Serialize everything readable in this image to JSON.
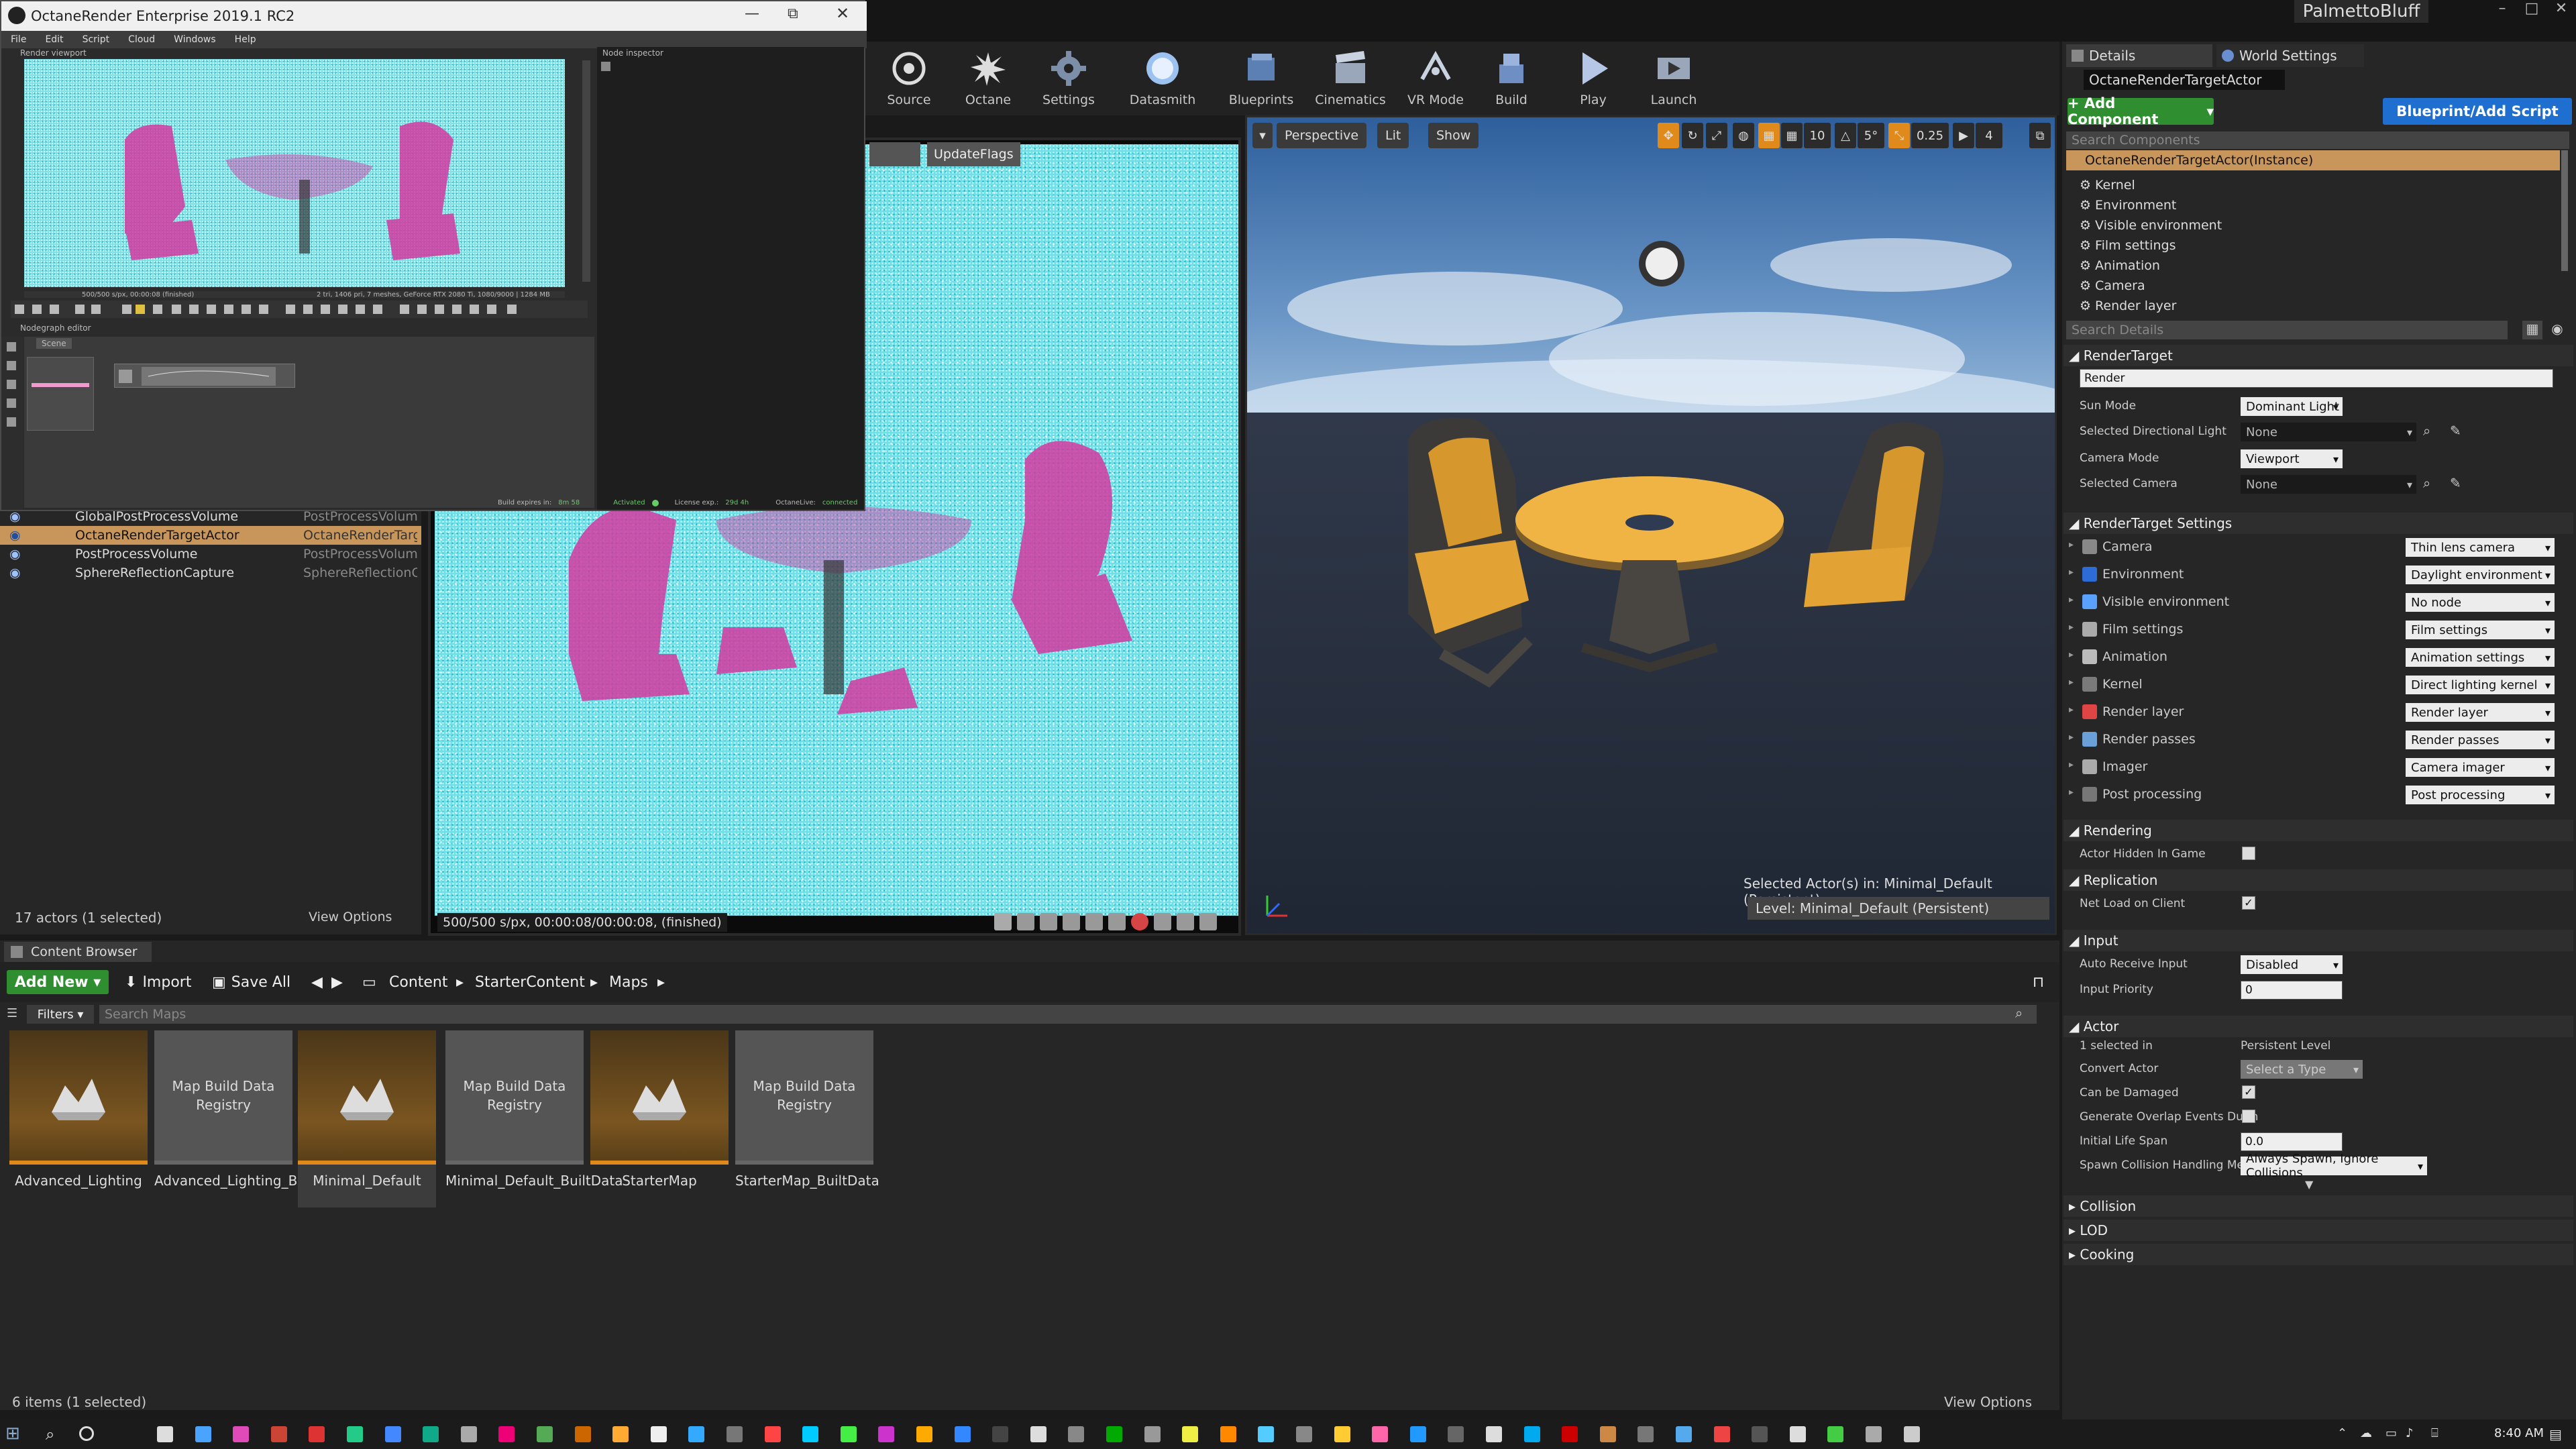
{
  "ue": {
    "project_name": "PalmettoBluff",
    "window_controls": [
      "–",
      "□",
      "✕"
    ]
  },
  "toolbar": [
    {
      "label": "Source",
      "icon": "source-control-icon"
    },
    {
      "label": "Octane",
      "icon": "octane-icon"
    },
    {
      "label": "Settings",
      "icon": "settings-gear-icon"
    },
    {
      "label": "Datasmith",
      "icon": "datasmith-icon"
    },
    {
      "label": "Blueprints",
      "icon": "blueprints-icon"
    },
    {
      "label": "Cinematics",
      "icon": "cinematics-icon"
    },
    {
      "label": "VR Mode",
      "icon": "vr-mode-icon"
    },
    {
      "label": "Build",
      "icon": "build-icon"
    },
    {
      "label": "Play",
      "icon": "play-icon"
    },
    {
      "label": "Launch",
      "icon": "launch-icon"
    }
  ],
  "octane_window": {
    "title": "OctaneRender Enterprise 2019.1 RC2",
    "menu": [
      "File",
      "Edit",
      "Script",
      "Cloud",
      "Windows",
      "Help"
    ],
    "render_viewport_label": "Render viewport",
    "node_inspector_label": "Node inspector",
    "nodegraph_label": "Nodegraph editor",
    "scene_tab": "Scene",
    "status_left": "500/500 s/px, 00:00:08 (finished)",
    "status_right": "2 tri, 1406 pri, 7 meshes, GeForce RTX 2080 Ti, 1080/9000 | 1284 MB",
    "footer": {
      "build_expires": "Build expires in:",
      "build_expires_val": "8m 58",
      "activated": "Activated",
      "license_exp": "License exp.:",
      "license_exp_val": "29d 4h",
      "octanelive": "OctaneLive:",
      "octanelive_val": "connected"
    }
  },
  "render_view": {
    "update_flags": "UpdateFlags",
    "status": "500/500 s/px, 00:00:08/00:00:08, (finished)"
  },
  "viewport": {
    "perspective": "Perspective",
    "lit": "Lit",
    "show": "Show",
    "grid_snap": "10",
    "rot_snap": "5°",
    "scale_snap": "0.25",
    "camera_speed": "4",
    "selected_actors": "Selected Actor(s) in:  Minimal_Default (Persistent)",
    "level": "Level:  Minimal_Default (Persistent)"
  },
  "outliner": {
    "rows": [
      {
        "name": "GlobalPostProcessVolume",
        "type": "PostProcessVolume",
        "selected": false
      },
      {
        "name": "OctaneRenderTargetActor",
        "type": "OctaneRenderTarge",
        "selected": true
      },
      {
        "name": "PostProcessVolume",
        "type": "PostProcessVolume",
        "selected": false
      },
      {
        "name": "SphereReflectionCapture",
        "type": "SphereReflectionCap",
        "selected": false
      }
    ],
    "count": "17 actors (1 selected)",
    "view_options": "View Options"
  },
  "content_browser": {
    "tab": "Content Browser",
    "add_new": "Add New",
    "import": "Import",
    "save_all": "Save All",
    "breadcrumbs": [
      "Content",
      "StarterContent",
      "Maps"
    ],
    "filters": "Filters",
    "search_placeholder": "Search Maps",
    "items": [
      {
        "label": "Advanced_Lighting",
        "kind": "level",
        "thumb_text": ""
      },
      {
        "label": "Advanced_Lighting_BuiltData",
        "kind": "data",
        "thumb_text": "Map Build Data Registry"
      },
      {
        "label": "Minimal_Default",
        "kind": "level",
        "thumb_text": "",
        "selected": true
      },
      {
        "label": "Minimal_Default_BuiltData",
        "kind": "data",
        "thumb_text": "Map Build Data Registry"
      },
      {
        "label": "StarterMap",
        "kind": "level",
        "thumb_text": ""
      },
      {
        "label": "StarterMap_BuiltData",
        "kind": "data",
        "thumb_text": "Map Build Data Registry"
      }
    ],
    "count": "6 items (1 selected)",
    "view_options": "View Options"
  },
  "details": {
    "tab_details": "Details",
    "tab_world": "World Settings",
    "actor_name": "OctaneRenderTargetActor",
    "add_component": "+ Add Component",
    "blueprint_script": "Blueprint/Add Script",
    "search_components": "Search Components",
    "root_component": "OctaneRenderTargetActor(Instance)",
    "components": [
      "Kernel",
      "Environment",
      "Visible environment",
      "Film settings",
      "Animation",
      "Camera",
      "Render layer"
    ],
    "search_details": "Search Details",
    "render_target": {
      "title": "RenderTarget",
      "render_field": "Render",
      "sun_mode_label": "Sun Mode",
      "sun_mode": "Dominant Light",
      "sel_dir_light_label": "Selected Directional Light",
      "sel_dir_light": "None",
      "camera_mode_label": "Camera Mode",
      "camera_mode": "Viewport",
      "selected_camera_label": "Selected Camera",
      "selected_camera": "None"
    },
    "rt_settings": {
      "title": "RenderTarget Settings",
      "rows": [
        {
          "label": "Camera",
          "value": "Thin lens camera"
        },
        {
          "label": "Environment",
          "value": "Daylight environment"
        },
        {
          "label": "Visible environment",
          "value": "No node"
        },
        {
          "label": "Film settings",
          "value": "Film settings"
        },
        {
          "label": "Animation",
          "value": "Animation settings"
        },
        {
          "label": "Kernel",
          "value": "Direct lighting kernel"
        },
        {
          "label": "Render layer",
          "value": "Render layer"
        },
        {
          "label": "Render passes",
          "value": "Render passes"
        },
        {
          "label": "Imager",
          "value": "Camera imager"
        },
        {
          "label": "Post processing",
          "value": "Post processing"
        }
      ]
    },
    "rendering": {
      "title": "Rendering",
      "hidden_label": "Actor Hidden In Game"
    },
    "replication": {
      "title": "Replication",
      "net_load_label": "Net Load on Client"
    },
    "input": {
      "title": "Input",
      "auto_receive_label": "Auto Receive Input",
      "auto_receive": "Disabled",
      "priority_label": "Input Priority",
      "priority": "0"
    },
    "actor": {
      "title": "Actor",
      "selected_in_label": "1 selected in",
      "selected_in": "Persistent Level",
      "convert_label": "Convert Actor",
      "convert": "Select a Type",
      "damaged_label": "Can be Damaged",
      "overlap_label": "Generate Overlap Events Durin",
      "lifespan_label": "Initial Life Span",
      "lifespan": "0.0",
      "spawn_label": "Spawn Collision Handling Meth",
      "spawn": "Always Spawn, Ignore Collisions"
    },
    "collapsed_sections": [
      "Collision",
      "LOD",
      "Cooking"
    ]
  },
  "taskbar": {
    "time": "8:40 AM"
  }
}
